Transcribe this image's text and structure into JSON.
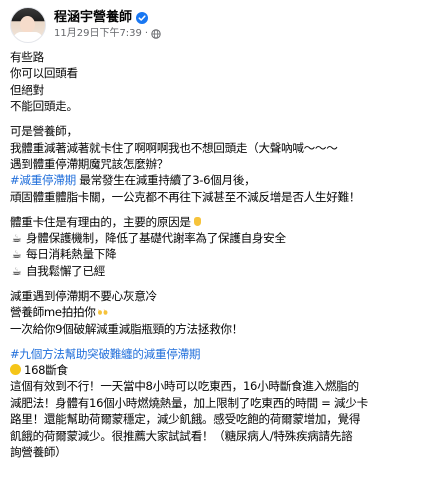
{
  "post": {
    "author": "程涵宇營養師",
    "timestamp": "11月29日下午7:39",
    "separator": "·",
    "privacy_icon": "globe-icon",
    "verified_icon": "verified-badge-icon",
    "accent_color": "#216fdb"
  },
  "body": {
    "intro_lines": [
      "有些路",
      "你可以回頭看",
      "但絕對",
      "不能回頭走。"
    ],
    "p2_line1": "可是營養師，",
    "p2_line2": "我體重減著減著就卡住了啊啊啊我也不想回頭走（大聲吶喊～～～",
    "p2_line3": "遇到體重停滯期魔咒該怎麼辦？",
    "p2_hashtag": "#減重停滯期",
    "p2_line4_rest": " 最常發生在減重持續了3-6個月後，",
    "p2_line5": "頑固體重體脂卡關，一公克都不再往下減甚至不減反增是否人生好難！",
    "reason_intro": "體重卡住是有理由的，主要的原因是",
    "reasons": [
      "身體保護機制，降低了基礎代謝率為了保護自身安全",
      "每日消耗熱量下降",
      "自我鬆懈了已經"
    ],
    "p4_line1": "減重遇到停滯期不要心灰意冷",
    "p4_line2": "營養師me拍拍你",
    "p4_line3": "一次給你9個破解減重減脂瓶頸的方法拯救你！",
    "section_hashtag": "#九個方法幫助突破難纏的減重停滯期",
    "section_title": "168斷食",
    "section_lines": [
      "這個有效到不行！一天當中8小時可以吃東西，16小時斷食進入燃脂的",
      "減肥法！身體有16個小時燃燒熱量，加上限制了吃東西的時間 = 減少卡",
      "路里！還能幫助荷爾蒙穩定，減少飢餓。感受吃飽的荷爾蒙增加，覺得",
      "飢餓的荷爾蒙減少。很推薦大家試試看！（糖尿病人/特殊疾病請先諮",
      "詢營養師）"
    ]
  }
}
